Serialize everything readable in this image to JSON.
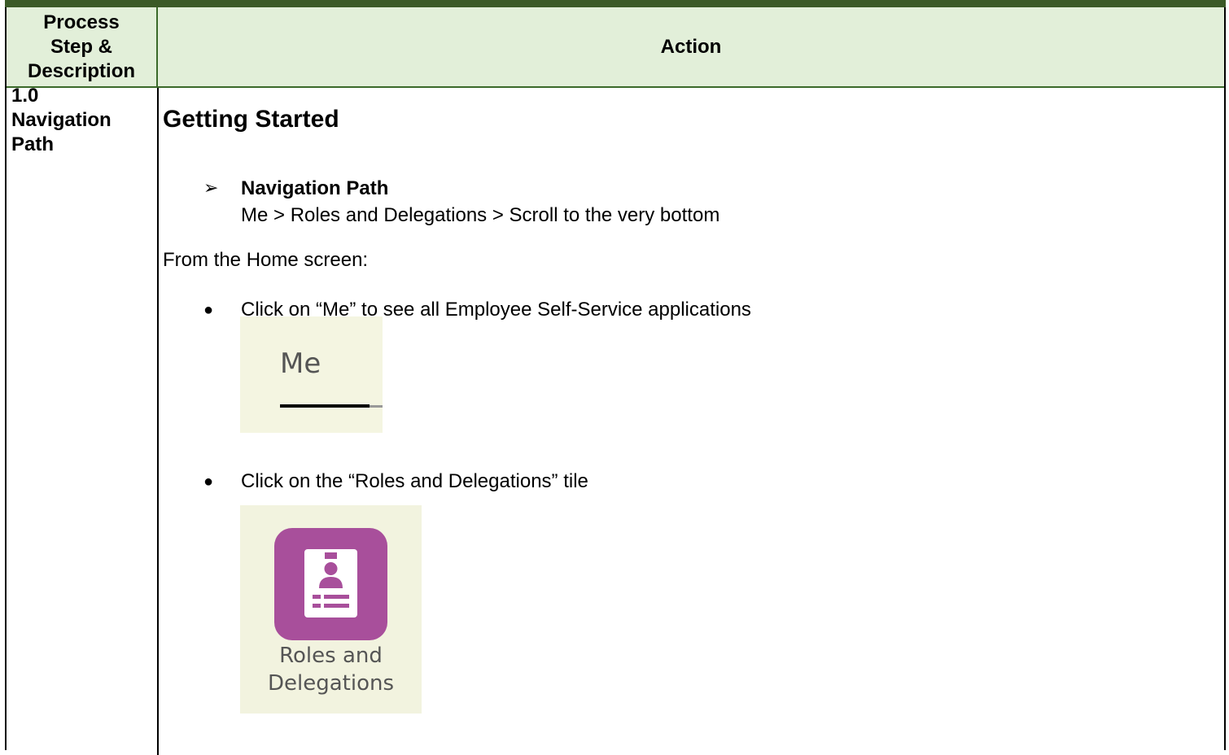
{
  "table": {
    "header": {
      "col1": "Process\nStep &\nDescription",
      "col2": "Action"
    },
    "row": {
      "step": "1.0\nNavigation\nPath",
      "section_title": "Getting Started",
      "nav_arrow": "➢",
      "nav_heading": "Navigation Path",
      "nav_path": "Me > Roles and Delegations > Scroll to the very bottom",
      "from_home": "From the Home screen:",
      "bullet": "●",
      "steps": [
        {
          "text": "Click on “Me” to see all Employee Self-Service applications"
        },
        {
          "text": "Click on the “Roles and Delegations” tile"
        }
      ],
      "me_image_label": "Me",
      "tile_label": "Roles and\nDelegations",
      "tile_icon": "id-card-icon",
      "tile_color": "#a84f9b"
    }
  },
  "colors": {
    "header_bg": "#e2efd9",
    "top_band": "#3b5a27",
    "image_bg": "#f4f5e1"
  }
}
